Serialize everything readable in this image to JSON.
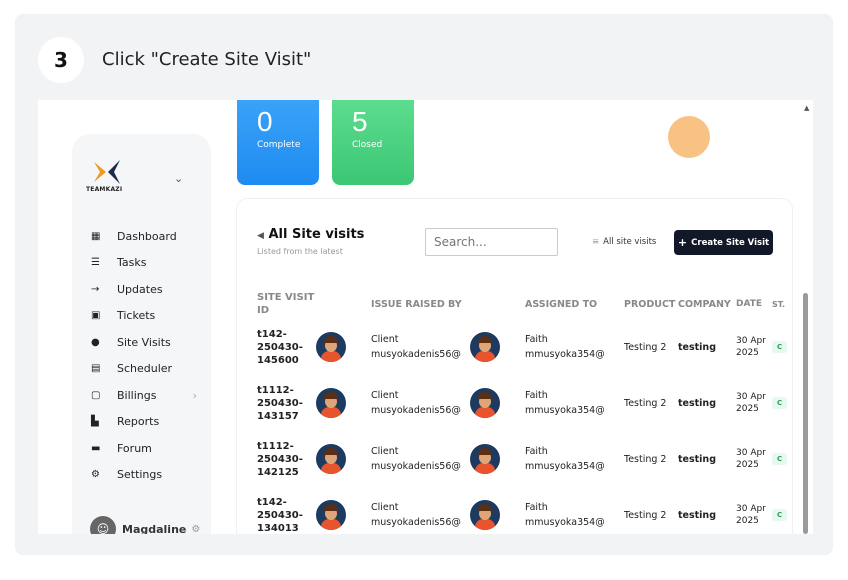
{
  "step": {
    "number": "3",
    "instruction": "Click \"Create Site Visit\""
  },
  "sidebar": {
    "brand": "TEAMKAZI",
    "items": [
      {
        "label": "Dashboard",
        "icon": "dashboard-icon"
      },
      {
        "label": "Tasks",
        "icon": "tasks-icon"
      },
      {
        "label": "Updates",
        "icon": "updates-icon"
      },
      {
        "label": "Tickets",
        "icon": "tickets-icon"
      },
      {
        "label": "Site Visits",
        "icon": "location-pin-icon"
      },
      {
        "label": "Scheduler",
        "icon": "calendar-icon"
      },
      {
        "label": "Billings",
        "icon": "billing-icon"
      },
      {
        "label": "Reports",
        "icon": "reports-icon"
      },
      {
        "label": "Forum",
        "icon": "forum-icon"
      },
      {
        "label": "Settings",
        "icon": "settings-icon"
      }
    ],
    "user": "Magdaline"
  },
  "stats": [
    {
      "value": "0",
      "label": "Complete",
      "color": "#1d8bf1"
    },
    {
      "value": "5",
      "label": "Closed",
      "color": "#3bc774"
    }
  ],
  "panel": {
    "title": "All Site visits",
    "subtitle": "Listed from the latest",
    "search_placeholder": "Search...",
    "filter_label": "All site visits",
    "create_label": "Create Site Visit",
    "columns": [
      "SITE VISIT ID",
      "ISSUE RAISED BY",
      "ASSIGNED TO",
      "PRODUCT",
      "COMPANY",
      "DATE",
      "ST."
    ],
    "rows": [
      {
        "id": "t142-250430-145600",
        "raised_role": "Client",
        "raised_email": "musyokadenis56@",
        "assigned_name": "Faith",
        "assigned_email": "mmusyoka354@",
        "product": "Testing 2",
        "company": "testing",
        "date": "30 Apr 2025",
        "status": "C"
      },
      {
        "id": "t1112-250430-143157",
        "raised_role": "Client",
        "raised_email": "musyokadenis56@",
        "assigned_name": "Faith",
        "assigned_email": "mmusyoka354@",
        "product": "Testing 2",
        "company": "testing",
        "date": "30 Apr 2025",
        "status": "C"
      },
      {
        "id": "t1112-250430-142125",
        "raised_role": "Client",
        "raised_email": "musyokadenis56@",
        "assigned_name": "Faith",
        "assigned_email": "mmusyoka354@",
        "product": "Testing 2",
        "company": "testing",
        "date": "30 Apr 2025",
        "status": "C"
      },
      {
        "id": "t142-250430-134013",
        "raised_role": "Client",
        "raised_email": "musyokadenis56@",
        "assigned_name": "Faith",
        "assigned_email": "mmusyoka354@",
        "product": "Testing 2",
        "company": "testing",
        "date": "30 Apr 2025",
        "status": "C"
      }
    ]
  }
}
